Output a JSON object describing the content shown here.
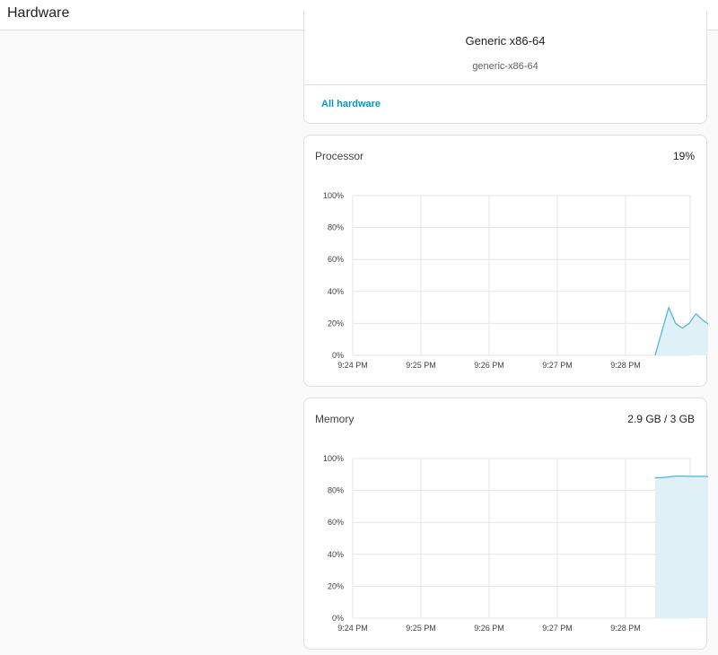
{
  "header": {
    "title": "Hardware"
  },
  "hardware_card": {
    "name": "Generic x86-64",
    "id": "generic-x86-64",
    "link_label": "All hardware",
    "link_color": "#0097c4"
  },
  "processor": {
    "label": "Processor",
    "value": "19%"
  },
  "memory": {
    "label": "Memory",
    "value": "2.9 GB / 3 GB"
  },
  "chart_data": [
    {
      "type": "area",
      "title": "Processor",
      "ylabel": "",
      "xlabel": "",
      "ylim": [
        0,
        100
      ],
      "y_ticks": [
        "0%",
        "20%",
        "40%",
        "60%",
        "80%",
        "100%"
      ],
      "x_ticks": [
        "9:24 PM",
        "9:25 PM",
        "9:26 PM",
        "9:27 PM",
        "9:28 PM"
      ],
      "grid": true,
      "color": "#4fb3d9",
      "fill": "#dff0f7",
      "series": [
        {
          "x": [
            "9:28:26 PM",
            "9:28:32 PM",
            "9:28:38 PM",
            "9:28:44 PM",
            "9:28:50 PM",
            "9:28:56 PM",
            "9:29:02 PM",
            "9:29:08 PM",
            "9:29:14 PM"
          ],
          "values": [
            0,
            15,
            30,
            20,
            17,
            20,
            26,
            22,
            19
          ]
        }
      ]
    },
    {
      "type": "area",
      "title": "Memory",
      "ylabel": "",
      "xlabel": "",
      "ylim": [
        0,
        100
      ],
      "y_ticks": [
        "0%",
        "20%",
        "40%",
        "60%",
        "80%",
        "100%"
      ],
      "x_ticks": [
        "9:24 PM",
        "9:25 PM",
        "9:26 PM",
        "9:27 PM",
        "9:28 PM"
      ],
      "grid": true,
      "color": "#4fb3d9",
      "fill": "#dff0f7",
      "series": [
        {
          "x": [
            "9:28:26 PM",
            "9:28:32 PM",
            "9:28:38 PM",
            "9:28:44 PM",
            "9:28:50 PM",
            "9:28:56 PM",
            "9:29:02 PM",
            "9:29:08 PM",
            "9:29:14 PM"
          ],
          "values": [
            88,
            88,
            88.5,
            89,
            89,
            88.8,
            88.8,
            88.8,
            88.6
          ]
        }
      ]
    }
  ]
}
